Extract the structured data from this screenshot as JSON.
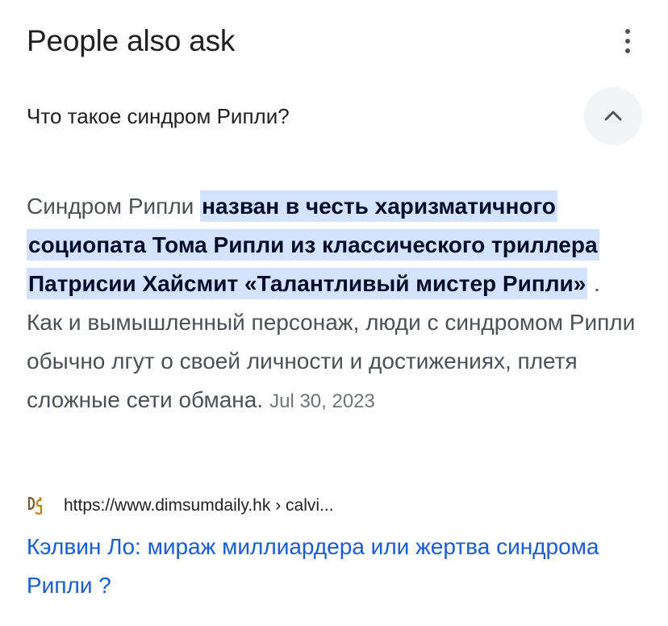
{
  "header": {
    "title": "People also ask",
    "more_icon": "more-vert-icon"
  },
  "question": {
    "text": "Что такое синдром Рипли?",
    "toggle_icon": "chevron-up-icon",
    "expanded": true
  },
  "answer": {
    "lead": "Синдром Рипли",
    "highlight": "назван в честь харизматичного социопата Тома Рипли из классического триллера Патрисии Хайсмит «Талантливый мистер Рипли»",
    "rest": " . Как и вымышленный персонаж, люди с синдромом Рипли обычно лгут о своей личности и достижениях, плетя сложные сети обмана.",
    "date": "Jul 30, 2023"
  },
  "source": {
    "favicon_icon": "dimsumdaily-favicon-icon",
    "url": "https://www.dimsumdaily.hk › calvi..."
  },
  "result": {
    "title": "Кэлвин Ло: мираж миллиардера или жертва синдрома Рипли ?"
  },
  "colors": {
    "highlight_bg": "#d3e3fd",
    "link": "#1a5bd6",
    "chevron_bg": "#f1f3f4",
    "body_text": "#4d5156"
  }
}
